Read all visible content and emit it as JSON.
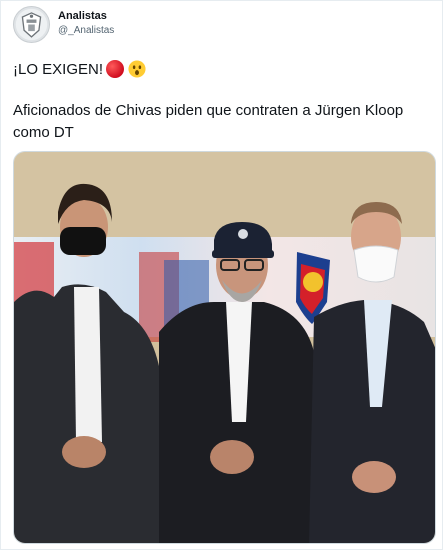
{
  "author": {
    "display_name": "Analistas",
    "handle": "@_Analistas",
    "avatar_icon": "club-crest-icon"
  },
  "tweet": {
    "headline": "¡LO EXIGEN!",
    "headline_emojis": [
      "red-circle-emoji",
      "astonished-face-emoji"
    ],
    "body": "Aficionados de Chivas piden que contraten a Jürgen Kloop como DT"
  },
  "media": {
    "kind": "photo",
    "description_icon": "photo-three-men-icon"
  },
  "colors": {
    "text_primary": "#0f1419",
    "text_secondary": "#536471",
    "border": "#cfd9de"
  }
}
